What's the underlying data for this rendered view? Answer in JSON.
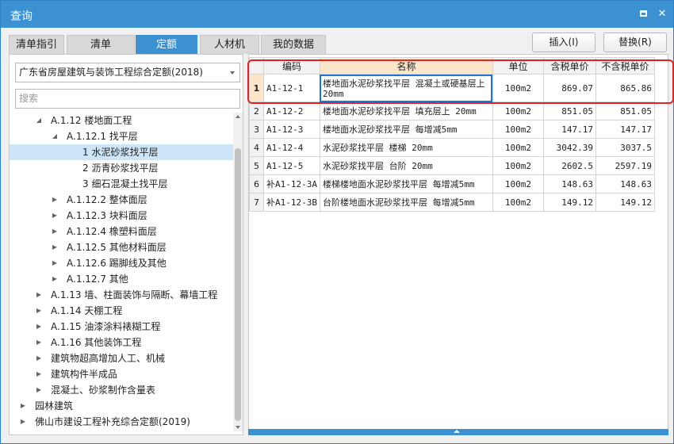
{
  "window": {
    "title": "查询"
  },
  "tabs": [
    {
      "label": "清单指引"
    },
    {
      "label": "清单"
    },
    {
      "label": "定额",
      "active": true
    },
    {
      "label": "人材机"
    },
    {
      "label": "我的数据"
    }
  ],
  "actions": {
    "insert_label": "插入(I)",
    "replace_label": "替换(R)"
  },
  "left": {
    "library_select": "广东省房屋建筑与装饰工程综合定额(2018)",
    "search_placeholder": "搜索",
    "tree": [
      {
        "label": "A.1.12 楼地面工程",
        "level": 1,
        "expander": "expanded"
      },
      {
        "label": "A.1.12.1 找平层",
        "level": 2,
        "expander": "expanded"
      },
      {
        "label": "1 水泥砂浆找平层",
        "level": 3,
        "expander": "none",
        "selected": true
      },
      {
        "label": "2 沥青砂浆找平层",
        "level": 3,
        "expander": "none"
      },
      {
        "label": "3 细石混凝土找平层",
        "level": 3,
        "expander": "none"
      },
      {
        "label": "A.1.12.2 整体面层",
        "level": 2,
        "expander": "collapsed"
      },
      {
        "label": "A.1.12.3 块料面层",
        "level": 2,
        "expander": "collapsed"
      },
      {
        "label": "A.1.12.4 橡塑料面层",
        "level": 2,
        "expander": "collapsed"
      },
      {
        "label": "A.1.12.5 其他材料面层",
        "level": 2,
        "expander": "collapsed"
      },
      {
        "label": "A.1.12.6 踢脚线及其他",
        "level": 2,
        "expander": "collapsed"
      },
      {
        "label": "A.1.12.7 其他",
        "level": 2,
        "expander": "collapsed"
      },
      {
        "label": "A.1.13 墙、柱面装饰与隔断、幕墙工程",
        "level": 1,
        "expander": "collapsed"
      },
      {
        "label": "A.1.14 天棚工程",
        "level": 1,
        "expander": "collapsed"
      },
      {
        "label": "A.1.15 油漆涂料裱糊工程",
        "level": 1,
        "expander": "collapsed"
      },
      {
        "label": "A.1.16 其他装饰工程",
        "level": 1,
        "expander": "collapsed"
      },
      {
        "label": "建筑物超高增加人工、机械",
        "level": 1,
        "expander": "collapsed"
      },
      {
        "label": "建筑构件半成品",
        "level": 1,
        "expander": "collapsed"
      },
      {
        "label": "混凝土、砂浆制作含量表",
        "level": 1,
        "expander": "collapsed"
      },
      {
        "label": "园林建筑",
        "level": 0,
        "expander": "collapsed"
      },
      {
        "label": "佛山市建设工程补充综合定额(2019)",
        "level": 0,
        "expander": "collapsed"
      }
    ]
  },
  "grid": {
    "columns": [
      "编码",
      "名称",
      "单位",
      "含税单价",
      "不含税单价"
    ],
    "rows": [
      {
        "idx": "1",
        "code": "A1-12-1",
        "name": "楼地面水泥砂浆找平层 混凝土或硬基层上 20mm",
        "unit": "100m2",
        "price_tax": "869.07",
        "price_notax": "865.86"
      },
      {
        "idx": "2",
        "code": "A1-12-2",
        "name": "楼地面水泥砂浆找平层 填充层上 20mm",
        "unit": "100m2",
        "price_tax": "851.05",
        "price_notax": "851.05"
      },
      {
        "idx": "3",
        "code": "A1-12-3",
        "name": "楼地面水泥砂浆找平层 每增减5mm",
        "unit": "100m2",
        "price_tax": "147.17",
        "price_notax": "147.17"
      },
      {
        "idx": "4",
        "code": "A1-12-4",
        "name": "水泥砂浆找平层 楼梯 20mm",
        "unit": "100m2",
        "price_tax": "3042.39",
        "price_notax": "3037.5"
      },
      {
        "idx": "5",
        "code": "A1-12-5",
        "name": "水泥砂浆找平层 台阶 20mm",
        "unit": "100m2",
        "price_tax": "2602.5",
        "price_notax": "2597.19"
      },
      {
        "idx": "6",
        "code": "补A1-12-3A",
        "name": "楼梯楼地面水泥砂浆找平层 每增减5mm",
        "unit": "100m2",
        "price_tax": "148.63",
        "price_notax": "148.63"
      },
      {
        "idx": "7",
        "code": "补A1-12-3B",
        "name": "台阶楼地面水泥砂浆找平层 每增减5mm",
        "unit": "100m2",
        "price_tax": "149.12",
        "price_notax": "149.12"
      }
    ]
  }
}
